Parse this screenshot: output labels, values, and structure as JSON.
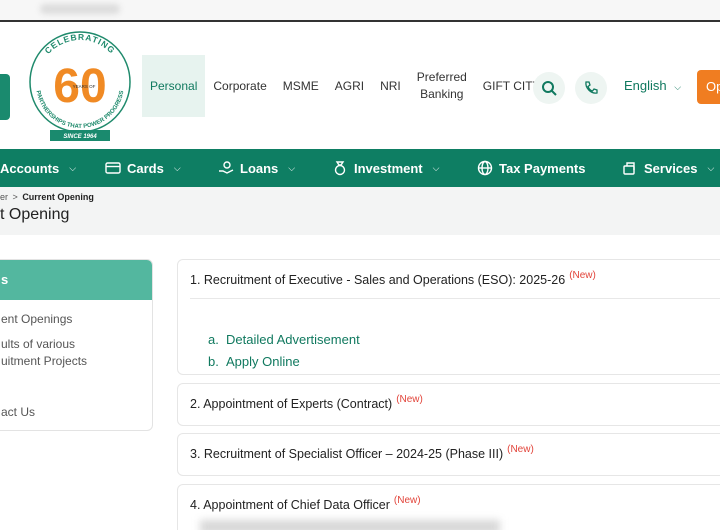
{
  "header": {
    "logo": {
      "ring_text_top": "CELEBRATING",
      "number": "60",
      "years_label_1": "YEARS OF",
      "ring_text_bottom": "PARTNERSHIPS THAT POWER PROGRESS",
      "since": "SINCE 1964"
    },
    "nav": [
      "Personal",
      "Corporate",
      "MSME",
      "AGRI",
      "NRI",
      "Preferred Banking",
      "GIFT CITY"
    ],
    "nav_preferred_line1": "Preferred",
    "nav_preferred_line2": "Banking",
    "language": "English",
    "open_button": "Op"
  },
  "menu": {
    "accounts": "Accounts",
    "cards": "Cards",
    "loans": "Loans",
    "investment": "Investment",
    "tax": "Tax Payments",
    "services": "Services"
  },
  "breadcrumb": {
    "prev": "er",
    "separator": ">",
    "current": "Current Opening"
  },
  "page_title": "t Opening",
  "sidebar": {
    "heading": "s",
    "links": [
      "ent Openings",
      "ults of various",
      "uitment Projects",
      "act Us"
    ]
  },
  "cards": [
    {
      "title": "1. Recruitment of Executive - Sales and Operations (ESO): 2025-26",
      "badge": "(New)",
      "links": [
        {
          "label": "a.",
          "text": "Detailed Advertisement"
        },
        {
          "label": "b.",
          "text": "Apply Online"
        }
      ]
    },
    {
      "title": "2. Appointment of Experts (Contract)",
      "badge": "(New)"
    },
    {
      "title": "3. Recruitment of Specialist Officer – 2024-25 (Phase III)",
      "badge": "(New)"
    },
    {
      "title": "4. Appointment of Chief Data Officer",
      "badge": "(New)"
    }
  ],
  "colors": {
    "brand_green": "#0e7e63",
    "sidebar_head": "#53b79f",
    "accent_orange": "#f07d21",
    "new_badge": "#e2443a"
  }
}
